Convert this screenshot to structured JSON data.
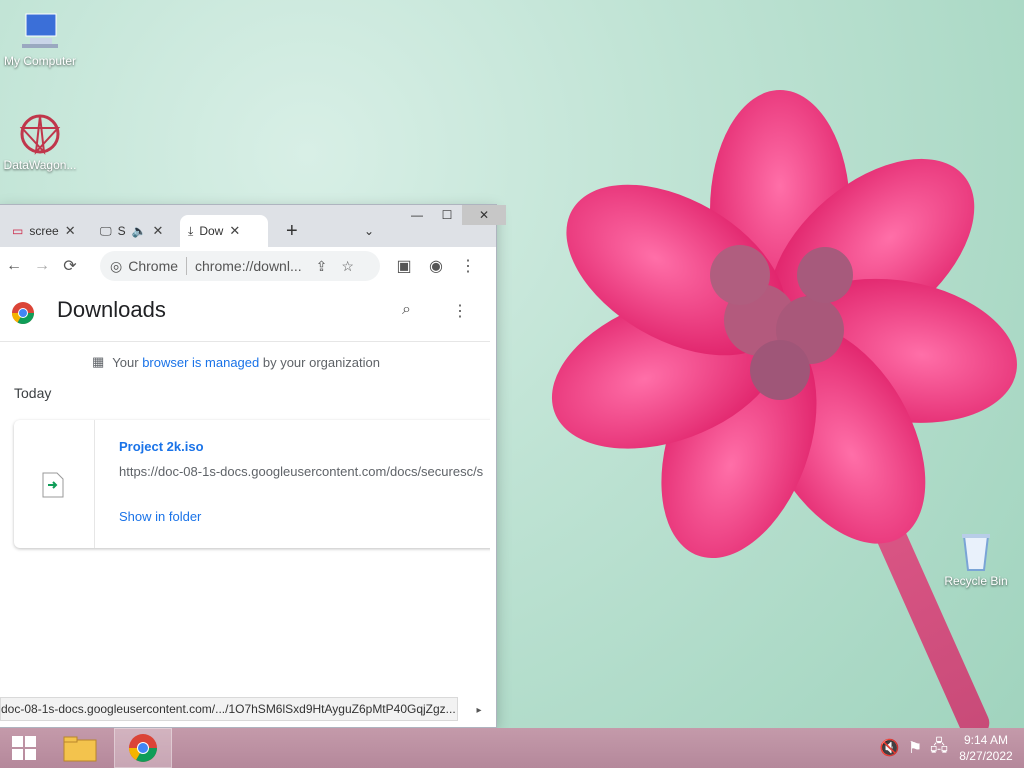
{
  "desktop": {
    "icons": [
      {
        "label": "My Computer"
      },
      {
        "label": "DataWagon..."
      },
      {
        "label": "Recycle Bin"
      }
    ]
  },
  "browser": {
    "tabs": [
      {
        "label": "scree",
        "icon": "screenshot-icon"
      },
      {
        "label": "S",
        "icon": "monitor-icon"
      },
      {
        "label": "Dow",
        "icon": "download-icon"
      }
    ],
    "new_tab": "+",
    "omnibox": {
      "scheme": "Chrome",
      "url": "chrome://downl..."
    },
    "status_url": "doc-08-1s-docs.googleusercontent.com/.../1O7hSM6lSxd9HtAyguZ6pMtP40GqjZgz..."
  },
  "downloads": {
    "title": "Downloads",
    "managed": {
      "prefix": "Your ",
      "link": "browser is managed",
      "suffix": " by your organization"
    },
    "section": "Today",
    "items": [
      {
        "filename": "Project 2k.iso",
        "url": "https://doc-08-1s-docs.googleusercontent.com/docs/securesc/s",
        "action": "Show in folder"
      }
    ]
  },
  "taskbar": {
    "time": "9:14 AM",
    "date": "8/27/2022"
  },
  "colors": {
    "accent": "#1a73e8",
    "taskbar": "#b88c9e"
  }
}
